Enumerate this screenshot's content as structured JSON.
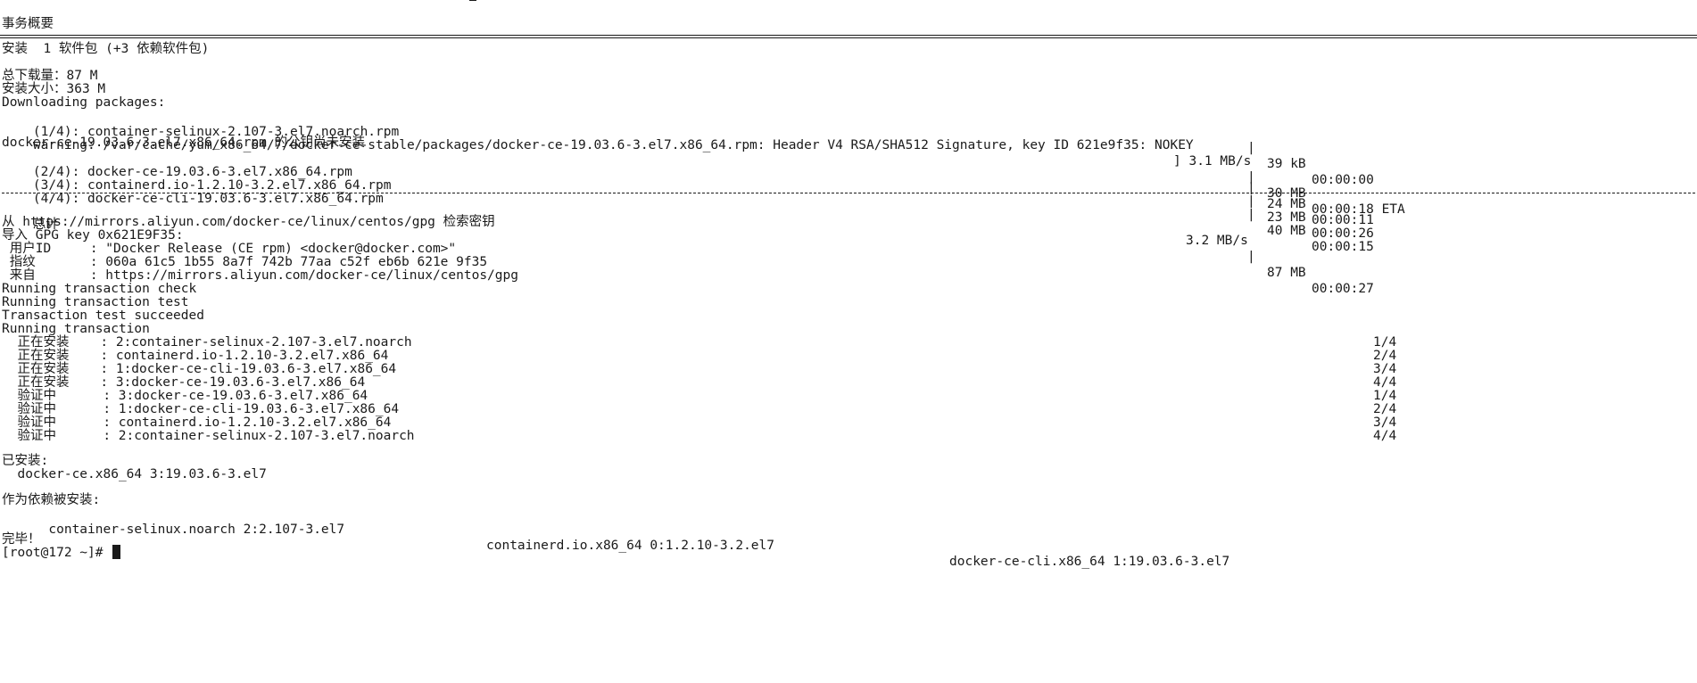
{
  "title": "事务概要",
  "install_summary": "安装  1 软件包 (+3 依赖软件包)",
  "total_download": "总下载量：87 M",
  "install_size": "安装大小：363 M",
  "downloading": "Downloading packages:",
  "downloads": [
    {
      "name": "(1/4): container-selinux-2.107-3.el7.noarch.rpm",
      "rate": "",
      "size": "39 kB",
      "time": "00:00:00"
    },
    {
      "name": "warning: /var/cache/yum/x86_64/7/docker-ce-stable/packages/docker-ce-19.03.6-3.el7.x86_64.rpm: Header V4 RSA/SHA512 Signature, key ID 621e9f35: NOKEY",
      "rate": "] 3.1 MB/s",
      "size": "30 MB",
      "time": "00:00:18 ETA"
    },
    {
      "name": "docker-ce-19.03.6-3.el7.x86_64.rpm 的公钥尚未安装",
      "rate": "",
      "size": "",
      "time": ""
    },
    {
      "name": "(2/4): docker-ce-19.03.6-3.el7.x86_64.rpm",
      "rate": "",
      "size": "24 MB",
      "time": "00:00:11"
    },
    {
      "name": "(3/4): containerd.io-1.2.10-3.2.el7.x86_64.rpm",
      "rate": "",
      "size": "23 MB",
      "time": "00:00:26"
    },
    {
      "name": "(4/4): docker-ce-cli-19.03.6-3.el7.x86_64.rpm",
      "rate": "",
      "size": "40 MB",
      "time": "00:00:15"
    }
  ],
  "total": {
    "label": "总计",
    "rate": "3.2 MB/s",
    "size": "87 MB",
    "time": "00:00:27"
  },
  "gpg_lines": [
    "从 https://mirrors.aliyun.com/docker-ce/linux/centos/gpg 检索密钥",
    "导入 GPG key 0x621E9F35:",
    " 用户ID     : \"Docker Release (CE rpm) <docker@docker.com>\"",
    " 指纹       : 060a 61c5 1b55 8a7f 742b 77aa c52f eb6b 621e 9f35",
    " 来自       : https://mirrors.aliyun.com/docker-ce/linux/centos/gpg"
  ],
  "tx_lines": [
    "Running transaction check",
    "Running transaction test",
    "Transaction test succeeded",
    "Running transaction"
  ],
  "steps": [
    {
      "action": "  正在安装    : 2:container-selinux-2.107-3.el7.noarch",
      "count": "1/4"
    },
    {
      "action": "  正在安装    : containerd.io-1.2.10-3.2.el7.x86_64",
      "count": "2/4"
    },
    {
      "action": "  正在安装    : 1:docker-ce-cli-19.03.6-3.el7.x86_64",
      "count": "3/4"
    },
    {
      "action": "  正在安装    : 3:docker-ce-19.03.6-3.el7.x86_64",
      "count": "4/4"
    },
    {
      "action": "  验证中      : 3:docker-ce-19.03.6-3.el7.x86_64",
      "count": "1/4"
    },
    {
      "action": "  验证中      : 1:docker-ce-cli-19.03.6-3.el7.x86_64",
      "count": "2/4"
    },
    {
      "action": "  验证中      : containerd.io-1.2.10-3.2.el7.x86_64",
      "count": "3/4"
    },
    {
      "action": "  验证中      : 2:container-selinux-2.107-3.el7.noarch",
      "count": "4/4"
    }
  ],
  "installed_label": "已安装:",
  "installed": "  docker-ce.x86_64 3:19.03.6-3.el7",
  "deps_label": "作为依赖被安装:",
  "deps": [
    "  container-selinux.noarch 2:2.107-3.el7",
    "containerd.io.x86_64 0:1.2.10-3.2.el7",
    "docker-ce-cli.x86_64 1:19.03.6-3.el7"
  ],
  "done": "完毕！",
  "prompt": "[root@172 ~]# "
}
